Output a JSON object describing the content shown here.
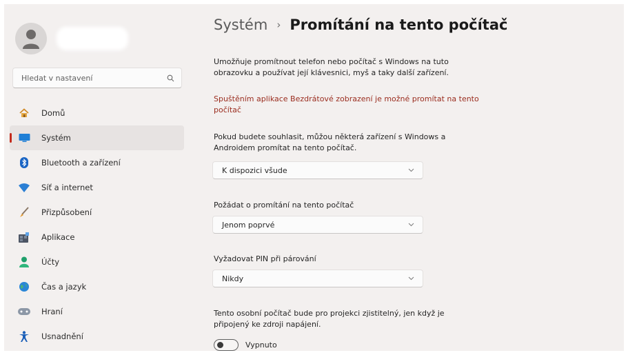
{
  "search": {
    "placeholder": "Hledat v nastavení"
  },
  "sidebar": {
    "items": [
      {
        "label": "Domů"
      },
      {
        "label": "Systém"
      },
      {
        "label": "Bluetooth a zařízení"
      },
      {
        "label": "Síť a internet"
      },
      {
        "label": "Přizpůsobení"
      },
      {
        "label": "Aplikace"
      },
      {
        "label": "Účty"
      },
      {
        "label": "Čas a jazyk"
      },
      {
        "label": "Hraní"
      },
      {
        "label": "Usnadnění"
      }
    ]
  },
  "header": {
    "parent": "Systém",
    "separator": "›",
    "title": "Promítání na tento počítač"
  },
  "main": {
    "description_line1": "Umožňuje promítnout telefon nebo počítač s Windows na tuto",
    "description_line2": "obrazovku a používat její klávesnici, myš a taky další zařízení.",
    "warning_line1": "Spuštěním aplikace Bezdrátové zobrazení je možné promítat na tento",
    "warning_line2": "počítač",
    "availability": {
      "label_line1": "Pokud budete souhlasit, můžou některá zařízení s Windows a",
      "label_line2": "Androidem promítat na tento počítač.",
      "value": "K dispozici všude"
    },
    "ask": {
      "label": "Požádat o promítání na tento počítač",
      "value": "Jenom poprvé"
    },
    "pin": {
      "label": "Vyžadovat PIN při párování",
      "value": "Nikdy"
    },
    "power": {
      "label_line1": "Tento osobní počítač bude pro projekci zjistitelný, jen když je",
      "label_line2": "připojený ke zdroji napájení.",
      "toggle_label": "Vypnuto",
      "toggle_on": false
    }
  },
  "colors": {
    "accent": "#c42b1c",
    "warning_text": "#9a2c1e",
    "window_bg": "#f3f0ef"
  }
}
